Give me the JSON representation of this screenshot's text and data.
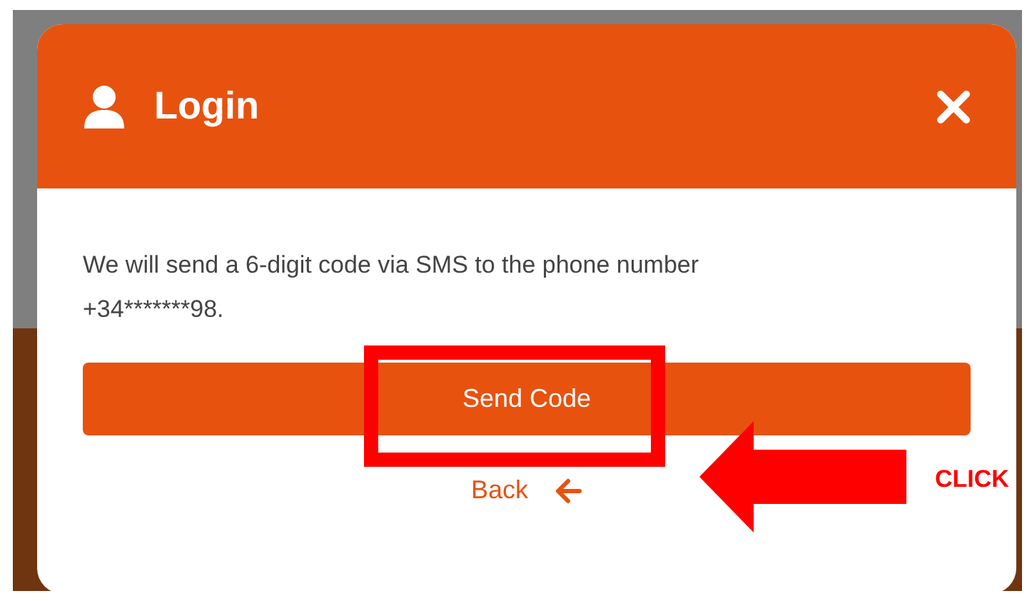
{
  "dialog": {
    "title": "Login",
    "message": "We will send a 6-digit code via SMS to the phone number +34*******98.",
    "primary_button": "Send Code",
    "back_link": "Back"
  },
  "annotation": {
    "label": "CLICK"
  }
}
